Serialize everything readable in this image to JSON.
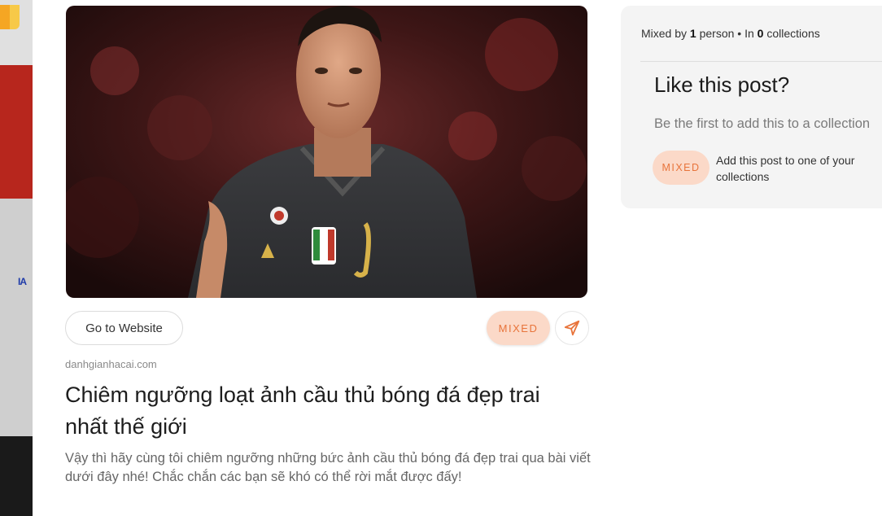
{
  "post": {
    "go_to_website_label": "Go to Website",
    "mixed_label": "MIXED",
    "share_icon": "send-icon",
    "domain": "danhgianhacai.com",
    "title": "Chiêm ngưỡng loạt ảnh cầu thủ bóng đá đẹp trai nhất thế giới",
    "description": "Vậy thì hãy cùng tôi chiêm ngưỡng những bức ảnh cầu thủ bóng đá đẹp trai qua bài viết dưới đây nhé! Chắc chắn các bạn sẽ khó có thể rời mắt được đấy!"
  },
  "sidebar": {
    "meta_prefix": "Mixed by ",
    "mixed_by_count": "1",
    "meta_person": " person • In ",
    "collections_count": "0",
    "meta_suffix": " collections",
    "like_title": "Like this post?",
    "be_first": "Be the first to add this to a collection",
    "mixed_label": "MIXED",
    "add_text": "Add this post to one of your collections"
  },
  "colors": {
    "accent": "#e8743b",
    "accent_bg": "#fbd9c8",
    "panel_bg": "#f4f4f4"
  }
}
